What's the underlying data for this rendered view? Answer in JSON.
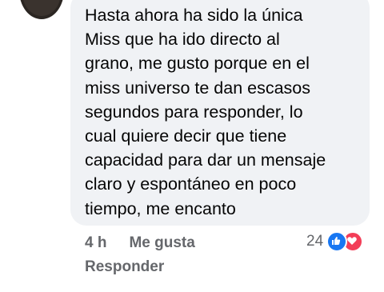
{
  "comment": {
    "text": "Hasta ahora ha sido la única\nMiss que ha ido directo al\ngrano, me gusto porque en el\nmiss universo te dan escasos\nsegundos para responder, lo\ncual quiere decir que tiene\ncapacidad para dar un mensaje\nclaro y espontáneo en poco\ntiempo, me encanto"
  },
  "meta": {
    "time": "4 h",
    "like_label": "Me gusta",
    "reply_label": "Responder"
  },
  "reactions": {
    "count": "24",
    "icons": [
      "like-icon",
      "love-icon"
    ]
  },
  "colors": {
    "bubble": "#f0f2f5",
    "text": "#050505",
    "meta": "#65676b",
    "like": "#1877f2",
    "love": "#f33e58"
  }
}
